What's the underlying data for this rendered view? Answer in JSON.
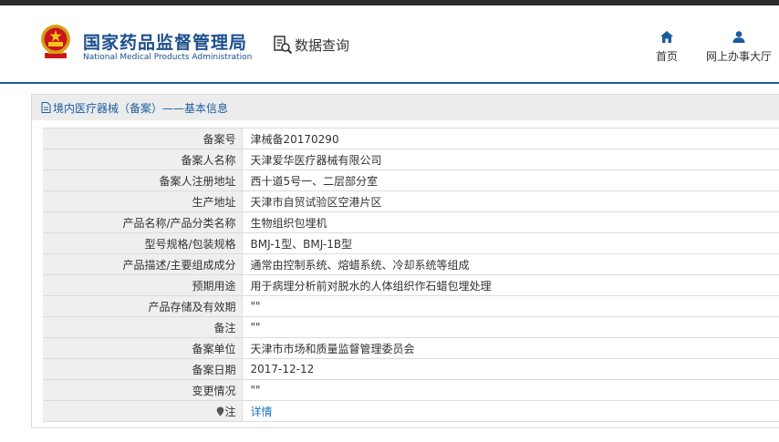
{
  "header": {
    "title_cn": "国家药品监督管理局",
    "title_en": "National Medical Products Administration",
    "data_query": "数据查询",
    "nav": {
      "home": "首页",
      "office": "网上办事大厅"
    }
  },
  "colors": {
    "brand_blue": "#1b4f8c",
    "header_line": "#1c5c9c",
    "link": "#1c6fc0"
  },
  "breadcrumb": {
    "text": "境内医疗器械（备案）——基本信息"
  },
  "record": [
    {
      "key": "备案号",
      "value": "津械备20170290"
    },
    {
      "key": "备案人名称",
      "value": "天津爱华医疗器械有限公司"
    },
    {
      "key": "备案人注册地址",
      "value": "西十道5号一、二层部分室"
    },
    {
      "key": "生产地址",
      "value": "天津市自贸试验区空港片区"
    },
    {
      "key": "产品名称/产品分类名称",
      "value": "生物组织包埋机"
    },
    {
      "key": "型号规格/包装规格",
      "value": "BMJ-1型、BMJ-1B型"
    },
    {
      "key": "产品描述/主要组成成分",
      "value": "通常由控制系统、熔蜡系统、冷却系统等组成"
    },
    {
      "key": "预期用途",
      "value": "用于病理分析前对脱水的人体组织作石蜡包埋处理"
    },
    {
      "key": "产品存储及有效期",
      "value": "\"\""
    },
    {
      "key": "备注",
      "value": "\"\""
    },
    {
      "key": "备案单位",
      "value": "天津市市场和质量监督管理委员会"
    },
    {
      "key": "备案日期",
      "value": "2017-12-12"
    },
    {
      "key": "变更情况",
      "value": "\"\""
    }
  ],
  "note": {
    "key": "注",
    "value": "详情"
  }
}
